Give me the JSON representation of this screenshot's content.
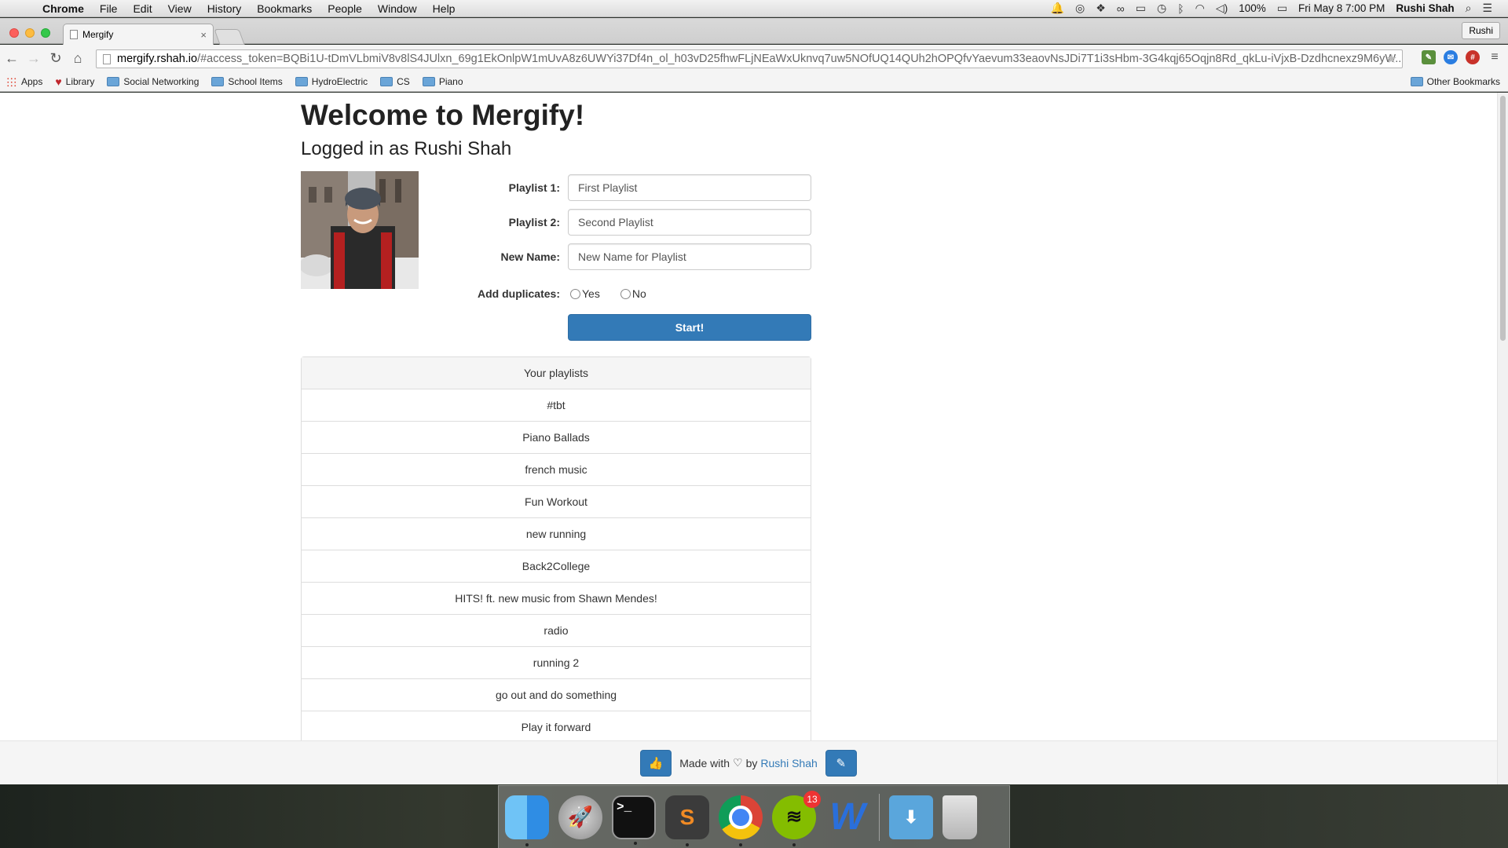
{
  "menubar": {
    "apple": "",
    "app_name": "Chrome",
    "menus": [
      "File",
      "Edit",
      "View",
      "History",
      "Bookmarks",
      "People",
      "Window",
      "Help"
    ],
    "battery": "100%",
    "clock": "Fri May 8  7:00 PM",
    "user": "Rushi Shah"
  },
  "browser": {
    "tab_title": "Mergify",
    "tab_close": "×",
    "profile": "Rushi",
    "url_host": "mergify.rshah.io",
    "url_path": "/#access_token=BQBi1U-tDmVLbmiV8v8lS4JUlxn_69g1EkOnlpW1mUvA8z6UWYi37Df4n_ol_h03vD25fhwFLjNEaWxUknvq7uw5NOfUQ14QUh2hOPQfvYaevum33eaovNsJDi7T1i3sHbm-3G4kqj65Oqjn8Rd_qkLu-iVjxB-Dzdhcnexz9M6yW...",
    "bookmarks": [
      {
        "label": "Apps",
        "icon": "apps-grid-icon"
      },
      {
        "label": "Library",
        "icon": "heart-icon"
      },
      {
        "label": "Social Networking",
        "icon": "folder-icon"
      },
      {
        "label": "School Items",
        "icon": "folder-icon"
      },
      {
        "label": "HydroElectric",
        "icon": "folder-icon"
      },
      {
        "label": "CS",
        "icon": "folder-icon"
      },
      {
        "label": "Piano",
        "icon": "folder-icon"
      }
    ],
    "other_bookmarks": "Other Bookmarks"
  },
  "page": {
    "title": "Welcome to Mergify!",
    "subtitle": "Logged in as Rushi Shah",
    "form": {
      "playlist1_label": "Playlist 1:",
      "playlist1_placeholder": "First Playlist",
      "playlist2_label": "Playlist 2:",
      "playlist2_placeholder": "Second Playlist",
      "newname_label": "New Name:",
      "newname_placeholder": "New Name for Playlist",
      "duplicates_label": "Add duplicates:",
      "yes_label": "Yes",
      "no_label": "No",
      "start_label": "Start!"
    },
    "playlists_header": "Your playlists",
    "playlists": [
      "#tbt",
      "Piano Ballads",
      "french music",
      "Fun Workout",
      "new running",
      "Back2College",
      "HITS! ft. new music from Shawn Mendes!",
      "radio",
      "running 2",
      "go out and do something",
      "Play it forward"
    ],
    "footer": {
      "made_with": "Made with",
      "heart": "♡",
      "by": "by",
      "author": "Rushi Shah"
    }
  },
  "dock": {
    "spotify_badge": "13"
  },
  "colors": {
    "primary": "#337ab7",
    "link": "#337ab7",
    "list_header_bg": "#f5f5f5"
  }
}
